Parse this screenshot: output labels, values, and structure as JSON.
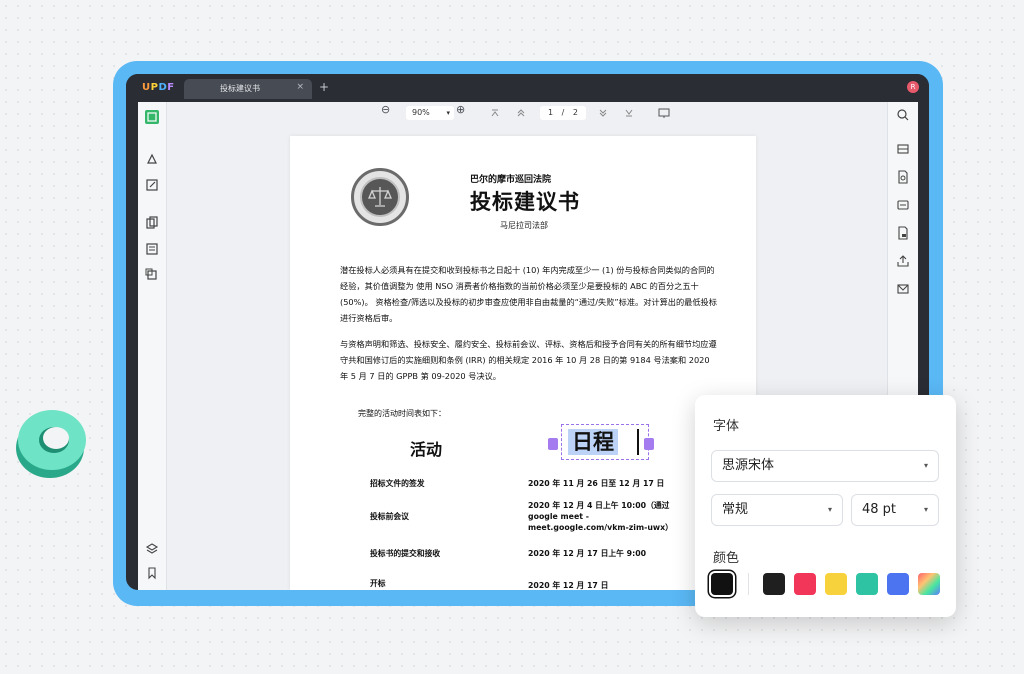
{
  "app": {
    "logo": "UPDF",
    "tab_title": "投标建议书",
    "tab_close": "×",
    "tab_add": "+",
    "avatar_initial": "R"
  },
  "toolbar": {
    "zoom_out": "⊖",
    "zoom_value": "90%",
    "zoom_caret": "▾",
    "zoom_in": "⊕",
    "page_current": "1",
    "page_sep": "/",
    "page_total": "2"
  },
  "document": {
    "org": "巴尔的摩市巡回法院",
    "title": "投标建议书",
    "dept": "马尼拉司法部",
    "para1": "潜在投标人必须具有在提交和收到投标书之日起十 (10) 年内完成至少一 (1) 份与投标合同类似的合同的经验，其价值调整为 使用 NSO 消费者价格指数的当前价格必须至少是要投标的 ABC 的百分之五十 (50%)。 资格检查/筛选以及投标的初步审查应使用非自由裁量的“通过/失败”标准。对计算出的最低投标进行资格后审。",
    "para2": "与资格声明和筛选、投标安全、履约安全、投标前会议、评标、资格后和授予合同有关的所有细节均应遵守共和国修订后的实施细则和条例 (IRR) 的相关规定 2016 年 10 月 28 日的第 9184 号法案和 2020 年 5 月 7 日的 GPPB 第 09-2020 号决议。",
    "schedule_intro": "完整的活动时间表如下：",
    "col_activity": "活动",
    "col_schedule": "日程",
    "rows": [
      {
        "activity": "招标文件的签发",
        "date": "2020 年 11 月 26 日至 12 月 17 日"
      },
      {
        "activity": "投标前会议",
        "date": "2020 年 12 月 4 日上午 10:00（通过 google meet - meet.google.com/vkm-zim-uwx）"
      },
      {
        "activity": "投标书的提交和接收",
        "date": "2020 年 12 月 17 日上午 9:00"
      },
      {
        "activity": "开标",
        "date": "2020 年 12 月 17 日"
      }
    ]
  },
  "font_panel": {
    "font_label": "字体",
    "font_value": "思源宋体",
    "style_value": "常规",
    "size_value": "48 pt",
    "color_label": "颜色",
    "caret": "▾",
    "colors": [
      "#111111",
      "#1f1f1f",
      "#f2365a",
      "#f7d23c",
      "#2ec4a3",
      "#4d74f0",
      "gradient"
    ]
  }
}
